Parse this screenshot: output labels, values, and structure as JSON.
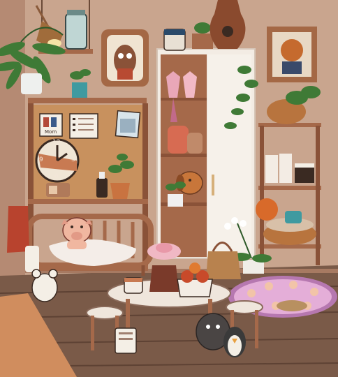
{
  "scene": {
    "note_label": "Mom",
    "clock_numbers": [
      "12",
      "3",
      "6",
      "9"
    ]
  },
  "colors": {
    "wall": "#c9a58e",
    "floor": "#7a5a48",
    "wood": "#a5694a",
    "cabinet": "#f3ece4",
    "rug": "#b678b0",
    "rug_dots": "#f2c4a8",
    "table": "#efe6dc"
  },
  "icons": [
    "fern-plant-icon",
    "lamp-icon",
    "jar-icon",
    "owl-portrait-icon",
    "vase-icon",
    "clock-icon",
    "pig-icon",
    "dog-plush-icon",
    "penguin-icon",
    "mouse-icon",
    "raccoon-icon",
    "clapperboard-icon"
  ]
}
